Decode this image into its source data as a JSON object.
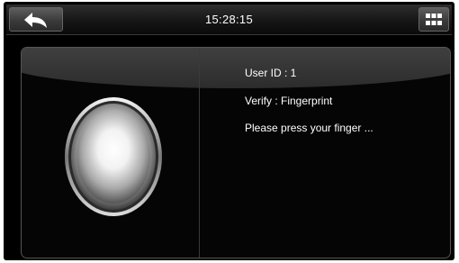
{
  "topbar": {
    "back_icon": "back-arrow-icon",
    "time": "15:28:15",
    "menu_icon": "grid-menu-icon"
  },
  "verify": {
    "sensor_icon": "fingerprint-sensor-icon",
    "user_id": "User ID : 1",
    "mode": "Verify : Fingerprint",
    "prompt": "Please press your finger ..."
  }
}
